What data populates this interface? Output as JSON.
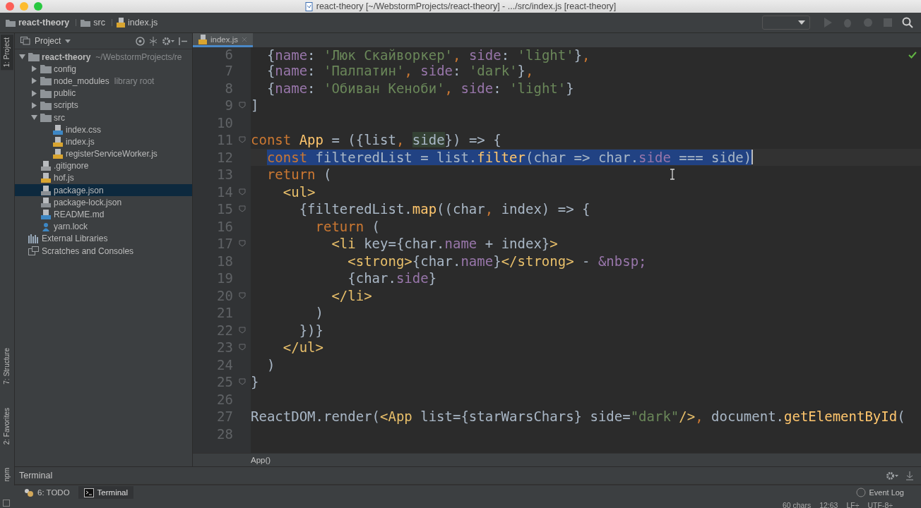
{
  "window": {
    "title": "react-theory [~/WebstormProjects/react-theory] - .../src/index.js [react-theory]"
  },
  "breadcrumbs": [
    {
      "label": "react-theory",
      "kind": "folder"
    },
    {
      "label": "src",
      "kind": "folder"
    },
    {
      "label": "index.js",
      "kind": "js"
    }
  ],
  "left_strip": [
    {
      "label": "1: Project",
      "selected": true
    },
    {
      "label": "7: Structure",
      "selected": false
    },
    {
      "label": "2: Favorites",
      "selected": false
    },
    {
      "label": "npm",
      "selected": false
    }
  ],
  "project_panel": {
    "title": "Project",
    "tree": [
      {
        "label": "react-theory",
        "kind": "folder",
        "hint": "~/WebstormProjects/re",
        "bold": true,
        "expanded": true,
        "selected": false,
        "children": [
          {
            "label": "config",
            "kind": "folder",
            "expanded": false,
            "selected": false
          },
          {
            "label": "node_modules",
            "kind": "folder",
            "hint": "library root",
            "expanded": false,
            "selected": false
          },
          {
            "label": "public",
            "kind": "folder",
            "expanded": false,
            "selected": false
          },
          {
            "label": "scripts",
            "kind": "folder",
            "expanded": false,
            "selected": false
          },
          {
            "label": "src",
            "kind": "folder",
            "expanded": true,
            "selected": false,
            "children": [
              {
                "label": "index.css",
                "kind": "css",
                "selected": false
              },
              {
                "label": "index.js",
                "kind": "js",
                "selected": false
              },
              {
                "label": "registerServiceWorker.js",
                "kind": "js",
                "selected": false
              }
            ]
          },
          {
            "label": ".gitignore",
            "kind": "text",
            "selected": false
          },
          {
            "label": "hof.js",
            "kind": "js",
            "selected": false
          },
          {
            "label": "package.json",
            "kind": "json",
            "selected": true
          },
          {
            "label": "package-lock.json",
            "kind": "json",
            "selected": false
          },
          {
            "label": "README.md",
            "kind": "md",
            "selected": false
          },
          {
            "label": "yarn.lock",
            "kind": "yarn",
            "selected": false
          }
        ]
      },
      {
        "label": "External Libraries",
        "kind": "libraries",
        "selected": false
      },
      {
        "label": "Scratches and Consoles",
        "kind": "scratches",
        "selected": false
      }
    ]
  },
  "editor": {
    "tabs": [
      {
        "label": "index.js",
        "selected": true
      }
    ],
    "lines": [
      {
        "number": "6",
        "fold": false,
        "selected": false,
        "tokens": [
          {
            "text": "{",
            "kind": "plain"
          },
          {
            "text": "name",
            "kind": "prop"
          },
          {
            "text": ": ",
            "kind": "plain"
          },
          {
            "text": "'Люк Скайворкер'",
            "kind": "str"
          },
          {
            "text": ", ",
            "kind": "kw"
          },
          {
            "text": "side",
            "kind": "prop"
          },
          {
            "text": ": ",
            "kind": "plain"
          },
          {
            "text": "'light'",
            "kind": "str"
          },
          {
            "text": "}",
            "kind": "plain"
          },
          {
            "text": ",",
            "kind": "kw"
          }
        ]
      },
      {
        "number": "7",
        "fold": false,
        "selected": false,
        "tokens": [
          {
            "text": "{",
            "kind": "plain"
          },
          {
            "text": "name",
            "kind": "prop"
          },
          {
            "text": ": ",
            "kind": "plain"
          },
          {
            "text": "'Палпатин'",
            "kind": "str"
          },
          {
            "text": ", ",
            "kind": "kw"
          },
          {
            "text": "side",
            "kind": "prop"
          },
          {
            "text": ": ",
            "kind": "plain"
          },
          {
            "text": "'dark'",
            "kind": "str"
          },
          {
            "text": "}",
            "kind": "plain"
          },
          {
            "text": ",",
            "kind": "kw"
          }
        ]
      },
      {
        "number": "8",
        "fold": false,
        "selected": false,
        "tokens": [
          {
            "text": "{",
            "kind": "plain"
          },
          {
            "text": "name",
            "kind": "prop"
          },
          {
            "text": ": ",
            "kind": "plain"
          },
          {
            "text": "'Обиван Кеноби'",
            "kind": "str"
          },
          {
            "text": ", ",
            "kind": "kw"
          },
          {
            "text": "side",
            "kind": "prop"
          },
          {
            "text": ": ",
            "kind": "plain"
          },
          {
            "text": "'light'",
            "kind": "str"
          },
          {
            "text": "}",
            "kind": "plain"
          }
        ]
      },
      {
        "number": "9",
        "fold": true,
        "selected": false,
        "tokens": [
          {
            "text": "]",
            "kind": "plain"
          }
        ]
      },
      {
        "number": "10",
        "fold": false,
        "selected": false
      },
      {
        "number": "11",
        "fold": true,
        "selected": false,
        "tokens": [
          {
            "text": "const",
            "kind": "kw"
          },
          {
            "text": " App",
            "kind": "fn"
          },
          {
            "text": " = ({list",
            "kind": "plain"
          },
          {
            "text": ", ",
            "kind": "kw"
          },
          {
            "text": "side",
            "kind": "usage"
          },
          {
            "text": "}) => {",
            "kind": "plain"
          }
        ]
      },
      {
        "number": "12",
        "fold": false,
        "selected": true,
        "tokens": [
          {
            "text": "const",
            "kind": "kw"
          },
          {
            "text": " filteredList = list.",
            "kind": "plain"
          },
          {
            "text": "filter",
            "kind": "fn"
          },
          {
            "text": "(char => char.",
            "kind": "plain"
          },
          {
            "text": "side",
            "kind": "prop"
          },
          {
            "text": " === side)",
            "kind": "plain"
          }
        ]
      },
      {
        "number": "13",
        "fold": false,
        "selected": false,
        "tokens": [
          {
            "text": "return",
            "kind": "kw"
          },
          {
            "text": " (",
            "kind": "plain"
          }
        ]
      },
      {
        "number": "14",
        "fold": true,
        "selected": false,
        "tokens": [
          {
            "text": "<ul>",
            "kind": "tag"
          }
        ]
      },
      {
        "number": "15",
        "fold": true,
        "selected": false,
        "tokens": [
          {
            "text": "{filteredList.",
            "kind": "plain"
          },
          {
            "text": "map",
            "kind": "fn"
          },
          {
            "text": "((char",
            "kind": "plain"
          },
          {
            "text": ", ",
            "kind": "kw"
          },
          {
            "text": "index) => {",
            "kind": "plain"
          }
        ]
      },
      {
        "number": "16",
        "fold": false,
        "selected": false,
        "tokens": [
          {
            "text": "return",
            "kind": "kw"
          },
          {
            "text": " (",
            "kind": "plain"
          }
        ]
      },
      {
        "number": "17",
        "fold": true,
        "selected": false,
        "tokens": [
          {
            "text": "<li ",
            "kind": "tag"
          },
          {
            "text": "key={char.",
            "kind": "plain"
          },
          {
            "text": "name",
            "kind": "prop"
          },
          {
            "text": " + index}",
            "kind": "plain"
          },
          {
            "text": ">",
            "kind": "tag"
          }
        ]
      },
      {
        "number": "18",
        "fold": false,
        "selected": false,
        "tokens": [
          {
            "text": "<strong>",
            "kind": "tag"
          },
          {
            "text": "{char.",
            "kind": "plain"
          },
          {
            "text": "name",
            "kind": "prop"
          },
          {
            "text": "}",
            "kind": "plain"
          },
          {
            "text": "</strong>",
            "kind": "tag"
          },
          {
            "text": " - ",
            "kind": "plain"
          },
          {
            "text": "&nbsp;",
            "kind": "prop"
          }
        ]
      },
      {
        "number": "19",
        "fold": false,
        "selected": false,
        "tokens": [
          {
            "text": "{char.",
            "kind": "plain"
          },
          {
            "text": "side",
            "kind": "prop"
          },
          {
            "text": "}",
            "kind": "plain"
          }
        ]
      },
      {
        "number": "20",
        "fold": true,
        "selected": false,
        "tokens": [
          {
            "text": "</li>",
            "kind": "tag"
          }
        ]
      },
      {
        "number": "21",
        "fold": false,
        "selected": false,
        "tokens": [
          {
            "text": ")",
            "kind": "plain"
          }
        ]
      },
      {
        "number": "22",
        "fold": true,
        "selected": false,
        "tokens": [
          {
            "text": "})}",
            "kind": "plain"
          }
        ]
      },
      {
        "number": "23",
        "fold": true,
        "selected": false,
        "tokens": [
          {
            "text": "</ul>",
            "kind": "tag"
          }
        ]
      },
      {
        "number": "24",
        "fold": false,
        "selected": false,
        "tokens": [
          {
            "text": ")",
            "kind": "plain"
          }
        ]
      },
      {
        "number": "25",
        "fold": true,
        "selected": false,
        "tokens": [
          {
            "text": "}",
            "kind": "plain"
          }
        ]
      },
      {
        "number": "26",
        "fold": false,
        "selected": false
      },
      {
        "number": "27",
        "fold": false,
        "selected": false,
        "tokens": [
          {
            "text": "ReactDOM.render(",
            "kind": "plain"
          },
          {
            "text": "<App ",
            "kind": "tag"
          },
          {
            "text": "list={starWarsChars} side=",
            "kind": "plain"
          },
          {
            "text": "\"dark\"",
            "kind": "str"
          },
          {
            "text": "/>",
            "kind": "tag"
          },
          {
            "text": ", ",
            "kind": "kw"
          },
          {
            "text": "document.",
            "kind": "plain"
          },
          {
            "text": "getElementById",
            "kind": "fn"
          },
          {
            "text": "(",
            "kind": "plain"
          }
        ]
      },
      {
        "number": "28",
        "fold": false,
        "selected": false
      }
    ],
    "breadcrumb": "App()"
  },
  "terminal": {
    "title": "Terminal"
  },
  "tool_tabs": [
    {
      "label": "6: TODO",
      "kind": "todo",
      "selected": false
    },
    {
      "label": "Terminal",
      "kind": "terminal",
      "selected": true
    }
  ],
  "status_bar": {
    "event_log": "Event Log",
    "items": [
      "60 chars",
      "12:63",
      "LF÷",
      "UTF-8÷"
    ]
  }
}
